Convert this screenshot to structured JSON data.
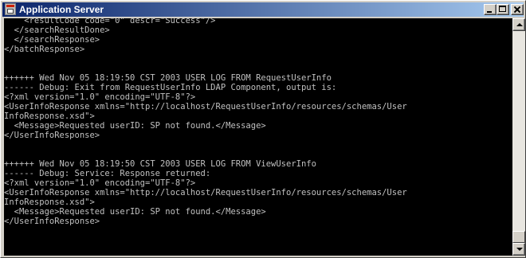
{
  "window": {
    "title": "Application Server"
  },
  "console": {
    "lines": [
      "    <resultCode code=\"0\" descr=\"Success\"/>",
      "  </searchResultDone>",
      "  </searchResponse>",
      "</batchResponse>",
      "",
      "",
      "++++++ Wed Nov 05 18:19:50 CST 2003 USER LOG FROM RequestUserInfo",
      "------ Debug: Exit from RequestUserInfo LDAP Component, output is:",
      "<?xml version=\"1.0\" encoding=\"UTF-8\"?>",
      "<UserInfoResponse xmlns=\"http://localhost/RequestUserInfo/resources/schemas/User",
      "InfoResponse.xsd\">",
      "  <Message>Requested userID: SP not found.</Message>",
      "</UserInfoResponse>",
      "",
      "",
      "++++++ Wed Nov 05 18:19:50 CST 2003 USER LOG FROM ViewUserInfo",
      "------ Debug: Service: Response returned:",
      "<?xml version=\"1.0\" encoding=\"UTF-8\"?>",
      "<UserInfoResponse xmlns=\"http://localhost/RequestUserInfo/resources/schemas/User",
      "InfoResponse.xsd\">",
      "  <Message>Requested userID: SP not found.</Message>",
      "</UserInfoResponse>"
    ]
  },
  "colors": {
    "console_background": "#000000",
    "console_text": "#c0c0c0",
    "titlebar_start": "#0a246a",
    "titlebar_end": "#a6caf0"
  },
  "icons": {
    "app": "application-icon",
    "minimize": "minimize-icon",
    "maximize": "maximize-icon",
    "close": "close-icon",
    "scroll_up": "arrow-up-icon",
    "scroll_down": "arrow-down-icon"
  }
}
